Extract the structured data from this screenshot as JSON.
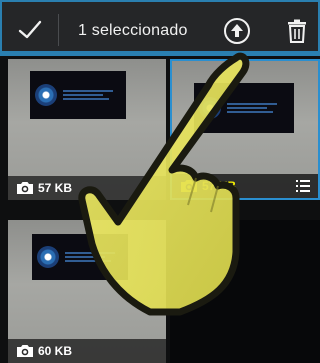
{
  "action_bar": {
    "done_icon": "check-icon",
    "title": "1 seleccionado",
    "upload_icon": "upload-circle-icon",
    "delete_icon": "trash-icon",
    "accent_color": "#2a7fb0"
  },
  "grid": {
    "items": [
      {
        "size": "57 KB",
        "selected": false,
        "icon": "camera-icon"
      },
      {
        "size": "57 KB",
        "selected": true,
        "icon": "camera-icon",
        "menu_icon": "list-menu-icon"
      },
      {
        "size": "60 KB",
        "selected": false,
        "icon": "camera-icon"
      }
    ],
    "selection_color": "#2a8fd0",
    "selected_text_color": "#f6f000"
  },
  "overlay": {
    "icon": "pointing-hand-icon",
    "color": "#ece857"
  }
}
